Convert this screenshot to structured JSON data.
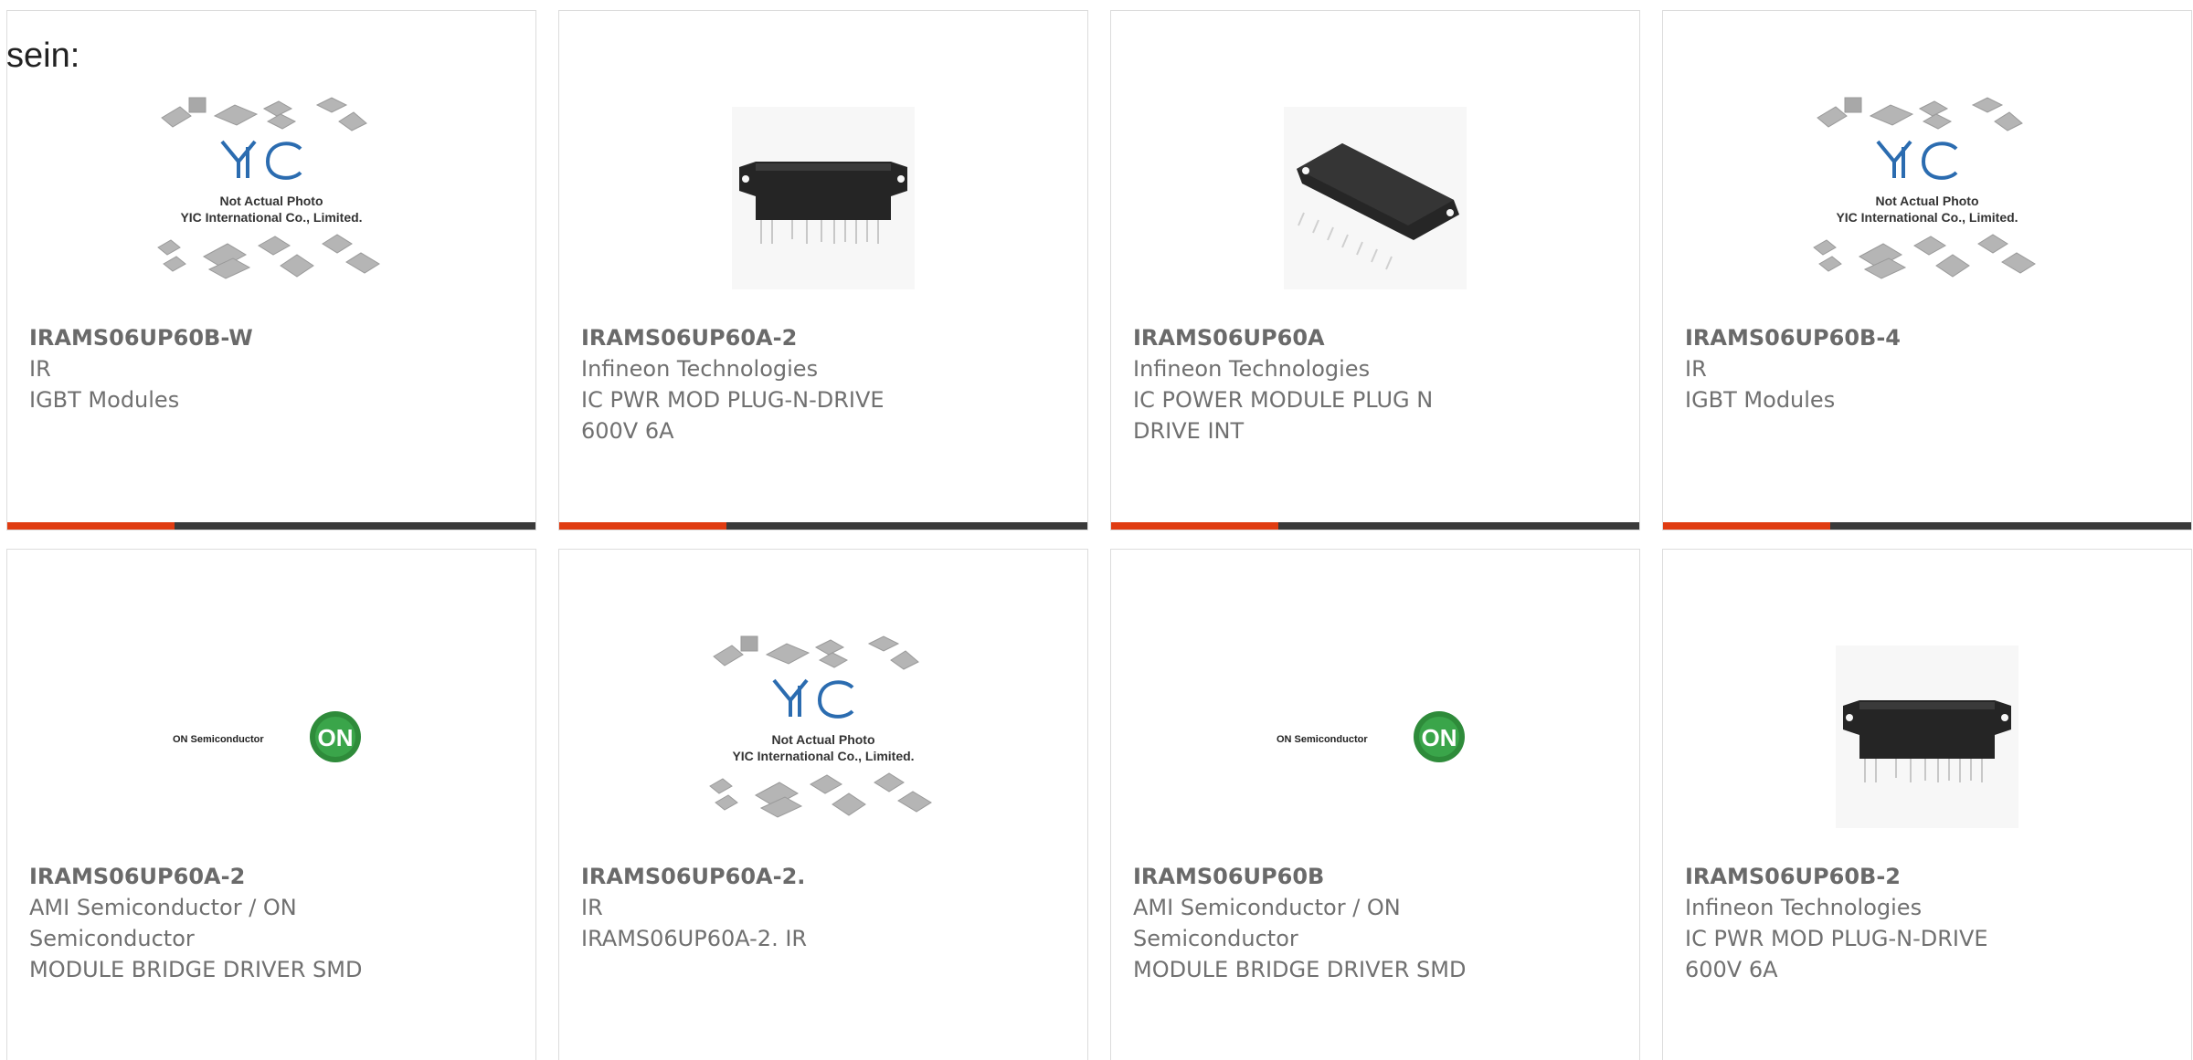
{
  "section_label": "sein:",
  "placeholder_image": {
    "caption_line1": "Not Actual Photo",
    "caption_line2": "YIC International Co., Limited."
  },
  "on_logo": {
    "wordmark": "ON Semiconductor",
    "badge": "ON"
  },
  "products": [
    {
      "part_number": "IRAMS06UP60B-W",
      "manufacturer": "IR",
      "description_line1": "IGBT Modules",
      "description_line2": "",
      "description_line3": "",
      "image": "yic-placeholder"
    },
    {
      "part_number": "IRAMS06UP60A-2",
      "manufacturer": "Infineon Technologies",
      "description_line1": "IC PWR MOD PLUG-N-DRIVE",
      "description_line2": "600V 6A",
      "description_line3": "",
      "image": "module-front-photo"
    },
    {
      "part_number": "IRAMS06UP60A",
      "manufacturer": "Infineon Technologies",
      "description_line1": "IC POWER MODULE PLUG N",
      "description_line2": "DRIVE INT",
      "description_line3": "",
      "image": "module-angled-photo"
    },
    {
      "part_number": "IRAMS06UP60B-4",
      "manufacturer": "IR",
      "description_line1": "IGBT Modules",
      "description_line2": "",
      "description_line3": "",
      "image": "yic-placeholder"
    },
    {
      "part_number": "IRAMS06UP60A-2",
      "manufacturer": "AMI Semiconductor / ON",
      "description_line1": "Semiconductor",
      "description_line2": "MODULE BRIDGE DRIVER SMD",
      "description_line3": "",
      "image": "on-semiconductor-logo"
    },
    {
      "part_number": "IRAMS06UP60A-2.",
      "manufacturer": "IR",
      "description_line1": "IRAMS06UP60A-2. IR",
      "description_line2": "",
      "description_line3": "",
      "image": "yic-placeholder"
    },
    {
      "part_number": "IRAMS06UP60B",
      "manufacturer": "AMI Semiconductor / ON",
      "description_line1": "Semiconductor",
      "description_line2": "MODULE BRIDGE DRIVER SMD",
      "description_line3": "",
      "image": "on-semiconductor-logo"
    },
    {
      "part_number": "IRAMS06UP60B-2",
      "manufacturer": "Infineon Technologies",
      "description_line1": "IC PWR MOD PLUG-N-DRIVE",
      "description_line2": "600V 6A",
      "description_line3": "",
      "image": "module-front-photo"
    }
  ],
  "colors": {
    "accent": "#e03c12",
    "bar": "#3a3a3a",
    "card_border": "#dcdcdc",
    "text": "#707070",
    "yic_blue": "#2b6cb0"
  }
}
